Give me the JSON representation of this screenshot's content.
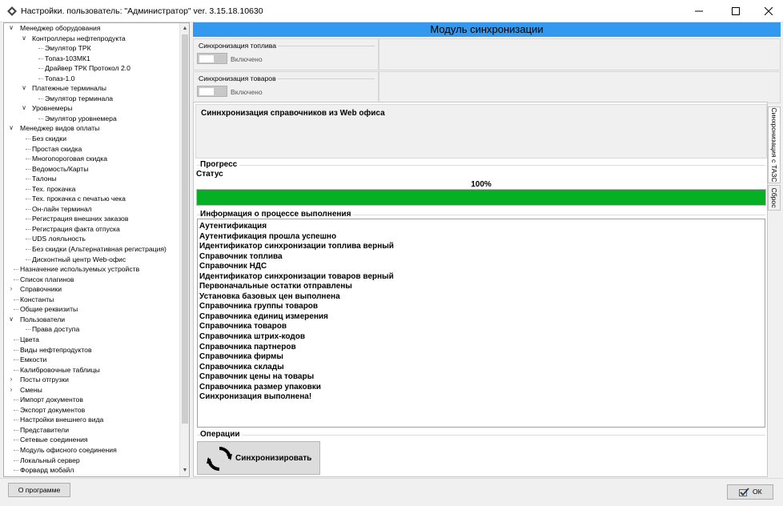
{
  "window": {
    "title": "Настройки. пользователь: \"Администратор\" ver. 3.15.18.10630",
    "app_icon": "diamond-icon"
  },
  "tree": {
    "items": [
      {
        "label": "Менеджер оборудования",
        "level": 0,
        "expanded": true
      },
      {
        "label": "Контроллеры нефтепродукта",
        "level": 1,
        "expanded": true
      },
      {
        "label": "Эмулятор ТРК",
        "level": 2
      },
      {
        "label": "Топаз-103МК1",
        "level": 2
      },
      {
        "label": "Драйвер ТРК Протокол 2.0",
        "level": 2
      },
      {
        "label": "Топаз-1.0",
        "level": 2
      },
      {
        "label": "Платежные терминалы",
        "level": 1,
        "expanded": true
      },
      {
        "label": "Эмулятор терминала",
        "level": 2
      },
      {
        "label": "Уровнемеры",
        "level": 1,
        "expanded": true
      },
      {
        "label": "Эмулятор уровнемера",
        "level": 2
      },
      {
        "label": "Менеджер видов оплаты",
        "level": 0,
        "expanded": true
      },
      {
        "label": "Без скидки",
        "level": 1
      },
      {
        "label": "Простая скидка",
        "level": 1
      },
      {
        "label": "Многопороговая скидка",
        "level": 1
      },
      {
        "label": "Ведомость/Карты",
        "level": 1
      },
      {
        "label": "Талоны",
        "level": 1
      },
      {
        "label": "Тех. прокачка",
        "level": 1
      },
      {
        "label": "Тех. прокачка с печатью чека",
        "level": 1
      },
      {
        "label": "Он-лайн терминал",
        "level": 1
      },
      {
        "label": "Регистрация внешних заказов",
        "level": 1
      },
      {
        "label": "Регистрация факта отпуска",
        "level": 1
      },
      {
        "label": "UDS лояльность",
        "level": 1
      },
      {
        "label": "Без скидки (Альтернативная регистрация)",
        "level": 1
      },
      {
        "label": "Дисконтный центр Web-офис",
        "level": 1
      },
      {
        "label": "Назначение используемых устройств",
        "level": 0
      },
      {
        "label": "Список плагинов",
        "level": 0
      },
      {
        "label": "Справочники",
        "level": 0,
        "expanded": false
      },
      {
        "label": "Константы",
        "level": 0
      },
      {
        "label": "Общие реквизиты",
        "level": 0
      },
      {
        "label": "Пользователи",
        "level": 0,
        "expanded": true
      },
      {
        "label": "Права доступа",
        "level": 1
      },
      {
        "label": "Цвета",
        "level": 0
      },
      {
        "label": "Виды нефтепродуктов",
        "level": 0
      },
      {
        "label": "Емкости",
        "level": 0
      },
      {
        "label": "Калибровочные таблицы",
        "level": 0
      },
      {
        "label": "Посты отгрузки",
        "level": 0,
        "expanded": false
      },
      {
        "label": "Смены",
        "level": 0,
        "expanded": false
      },
      {
        "label": "Импорт документов",
        "level": 0
      },
      {
        "label": "Экспорт документов",
        "level": 0
      },
      {
        "label": "Настройки внешнего вида",
        "level": 0
      },
      {
        "label": "Представители",
        "level": 0
      },
      {
        "label": "Сетевые соединения",
        "level": 0
      },
      {
        "label": "Модуль офисного соединения",
        "level": 0
      },
      {
        "label": "Локальный сервер",
        "level": 0
      },
      {
        "label": "Форвард мобайл",
        "level": 0
      }
    ]
  },
  "module": {
    "header": "Модуль синхронизации",
    "fuel_sync": {
      "title": "Синхронизация топлива",
      "toggle_label": "Включено"
    },
    "goods_sync": {
      "title": "Синхронизация товаров",
      "toggle_label": "Включено"
    },
    "dict_sync_title": "Синнхронизация справочников из Web офиса",
    "progress": {
      "title": "Прогресс",
      "status_label": "Статус",
      "percent_text": "100%",
      "value": 1.0,
      "bar_color": "#06b025"
    },
    "log": {
      "title": "Информация о процессе выполнения",
      "lines": [
        "Аутентификация",
        "Аутентификация прошла успешно",
        "Идентификатор синхронизации топлива верный",
        "Справочник топлива",
        "Справочник НДС",
        "Идентификатор синхронизации товаров верный",
        "Первоначальные остатки отправлены",
        "Установка базовых цен выполнена",
        "Справочника группы товаров",
        "Справочника единиц измерения",
        "Справочника товаров",
        "Справочника штрих-кодов",
        "Справочника партнеров",
        "Справочника фирмы",
        "Справочника склады",
        "Справочник цены на товары",
        "Справочника размер упаковки",
        "Синхронизация выполнена!"
      ]
    },
    "operations": {
      "title": "Операции",
      "sync_button_label": "Синхронизировать",
      "sync_icon": "refresh-icon"
    },
    "side_tabs": [
      "Синхронизация с ТАЗС",
      "Сброс"
    ],
    "header_color": "#3399ee"
  },
  "footer": {
    "about_label": "О программе",
    "ok_label": "ОК"
  }
}
